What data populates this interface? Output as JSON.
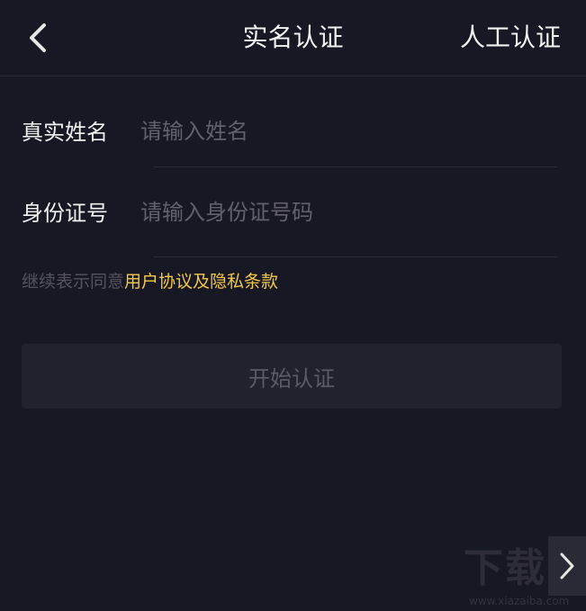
{
  "header": {
    "title": "实名认证",
    "manual_label": "人工认证"
  },
  "form": {
    "name": {
      "label": "真实姓名",
      "placeholder": "请输入姓名",
      "value": ""
    },
    "id_number": {
      "label": "身份证号",
      "placeholder": "请输入身份证号码",
      "value": ""
    }
  },
  "agreement": {
    "prefix": "继续表示同意",
    "link": "用户协议及隐私条款"
  },
  "start_button": {
    "label": "开始认证"
  },
  "watermark": {
    "logo": "下载吧",
    "url": "www.xiazaiba.com"
  },
  "colors": {
    "background": "#181724",
    "accent": "#f2c84b",
    "button_bg": "#22212e",
    "placeholder": "#62606d"
  },
  "icons": {
    "back": "chevron-left-icon",
    "next": "chevron-right-icon"
  }
}
